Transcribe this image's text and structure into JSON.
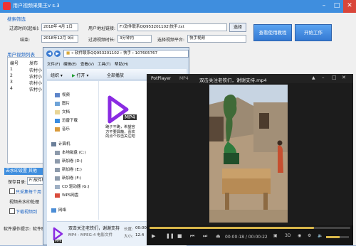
{
  "app": {
    "title": "用户视频采集王v s.3",
    "section_search": "搜索筛选",
    "label_date_from": "过滤时间(起始):",
    "date_from": "2018年 4月 1日",
    "label_end": "结束:",
    "date_end": "2018年12月 9日",
    "label_user_url": "用户地址链接:",
    "user_url": "F:\\软件联系QQ953201102\\快手.txt",
    "select_btn": "选择",
    "label_duration": "过滤视频时长:",
    "duration": "3分钟内",
    "label_platform": "选择视频平台:",
    "platform": "快手视频",
    "tutorial_btn": "查看使用教程",
    "start_btn": "开始工作",
    "section_users": "用户视频列表",
    "col_no": "编号",
    "col_pub": "发布",
    "rows": [
      {
        "no": "1",
        "name": "农村小"
      },
      {
        "no": "2",
        "name": "农村小"
      },
      {
        "no": "3",
        "name": "农村小"
      },
      {
        "no": "4",
        "name": "农村小"
      }
    ],
    "section_watermark": "去水印设置 其他",
    "label_save": "保存目录:",
    "save_dir": "F:\\软件联",
    "opt_download": "只采集每个用",
    "label_watermark": "视频去水印处理",
    "opt_done": "下载视频到",
    "status_label": "软件操作提示:",
    "status_value": "软件联系"
  },
  "explorer": {
    "breadcrumb_root": "软件联系QQ953201102",
    "breadcrumb_1": "快手",
    "breadcrumb_2": "107605767",
    "menu": [
      "文件(F)",
      "编辑(E)",
      "查看(V)",
      "工具(T)",
      "帮助(H)"
    ],
    "toolbar_organize": "组织",
    "toolbar_open": "打开",
    "toolbar_play": "全部播放",
    "nav": [
      {
        "label": "视频",
        "icon": "video-folder-icon"
      },
      {
        "label": "图片",
        "icon": "picture-folder-icon"
      },
      {
        "label": "文档",
        "icon": "document-folder-icon"
      },
      {
        "label": "迅雷下载",
        "icon": "thunder-download-icon"
      },
      {
        "label": "音乐",
        "icon": "music-folder-icon"
      }
    ],
    "computer": "计算机",
    "drives": [
      {
        "label": "本地磁盘 (C:)"
      },
      {
        "label": "新加卷 (D:)"
      },
      {
        "label": "新加卷 (E:)"
      },
      {
        "label": "新加卷 (F:)"
      },
      {
        "label": "CD 驱动器 (G:)"
      },
      {
        "label": "WPS网盘"
      }
    ],
    "network": "网络",
    "file_badge": "MP4",
    "file_caption": "跪子不跪，希望官方不要屏蔽，喜欢的点个双击关注吧",
    "details_name": "双击关注老铁们，谢谢支持",
    "details_type": "MP4 - MPEG-4 电影文件",
    "details_len_label": "长度:",
    "details_len_value": "00:00",
    "details_size_label": "大小:",
    "details_size_value": "12.4"
  },
  "player": {
    "app_name": "PotPlayer",
    "format": "MP4",
    "title": "双击关注老铁们，谢谢支持.mp4",
    "time": "00:00:18 / 00:00:22",
    "progress": 0.82,
    "volume": 0.6
  }
}
